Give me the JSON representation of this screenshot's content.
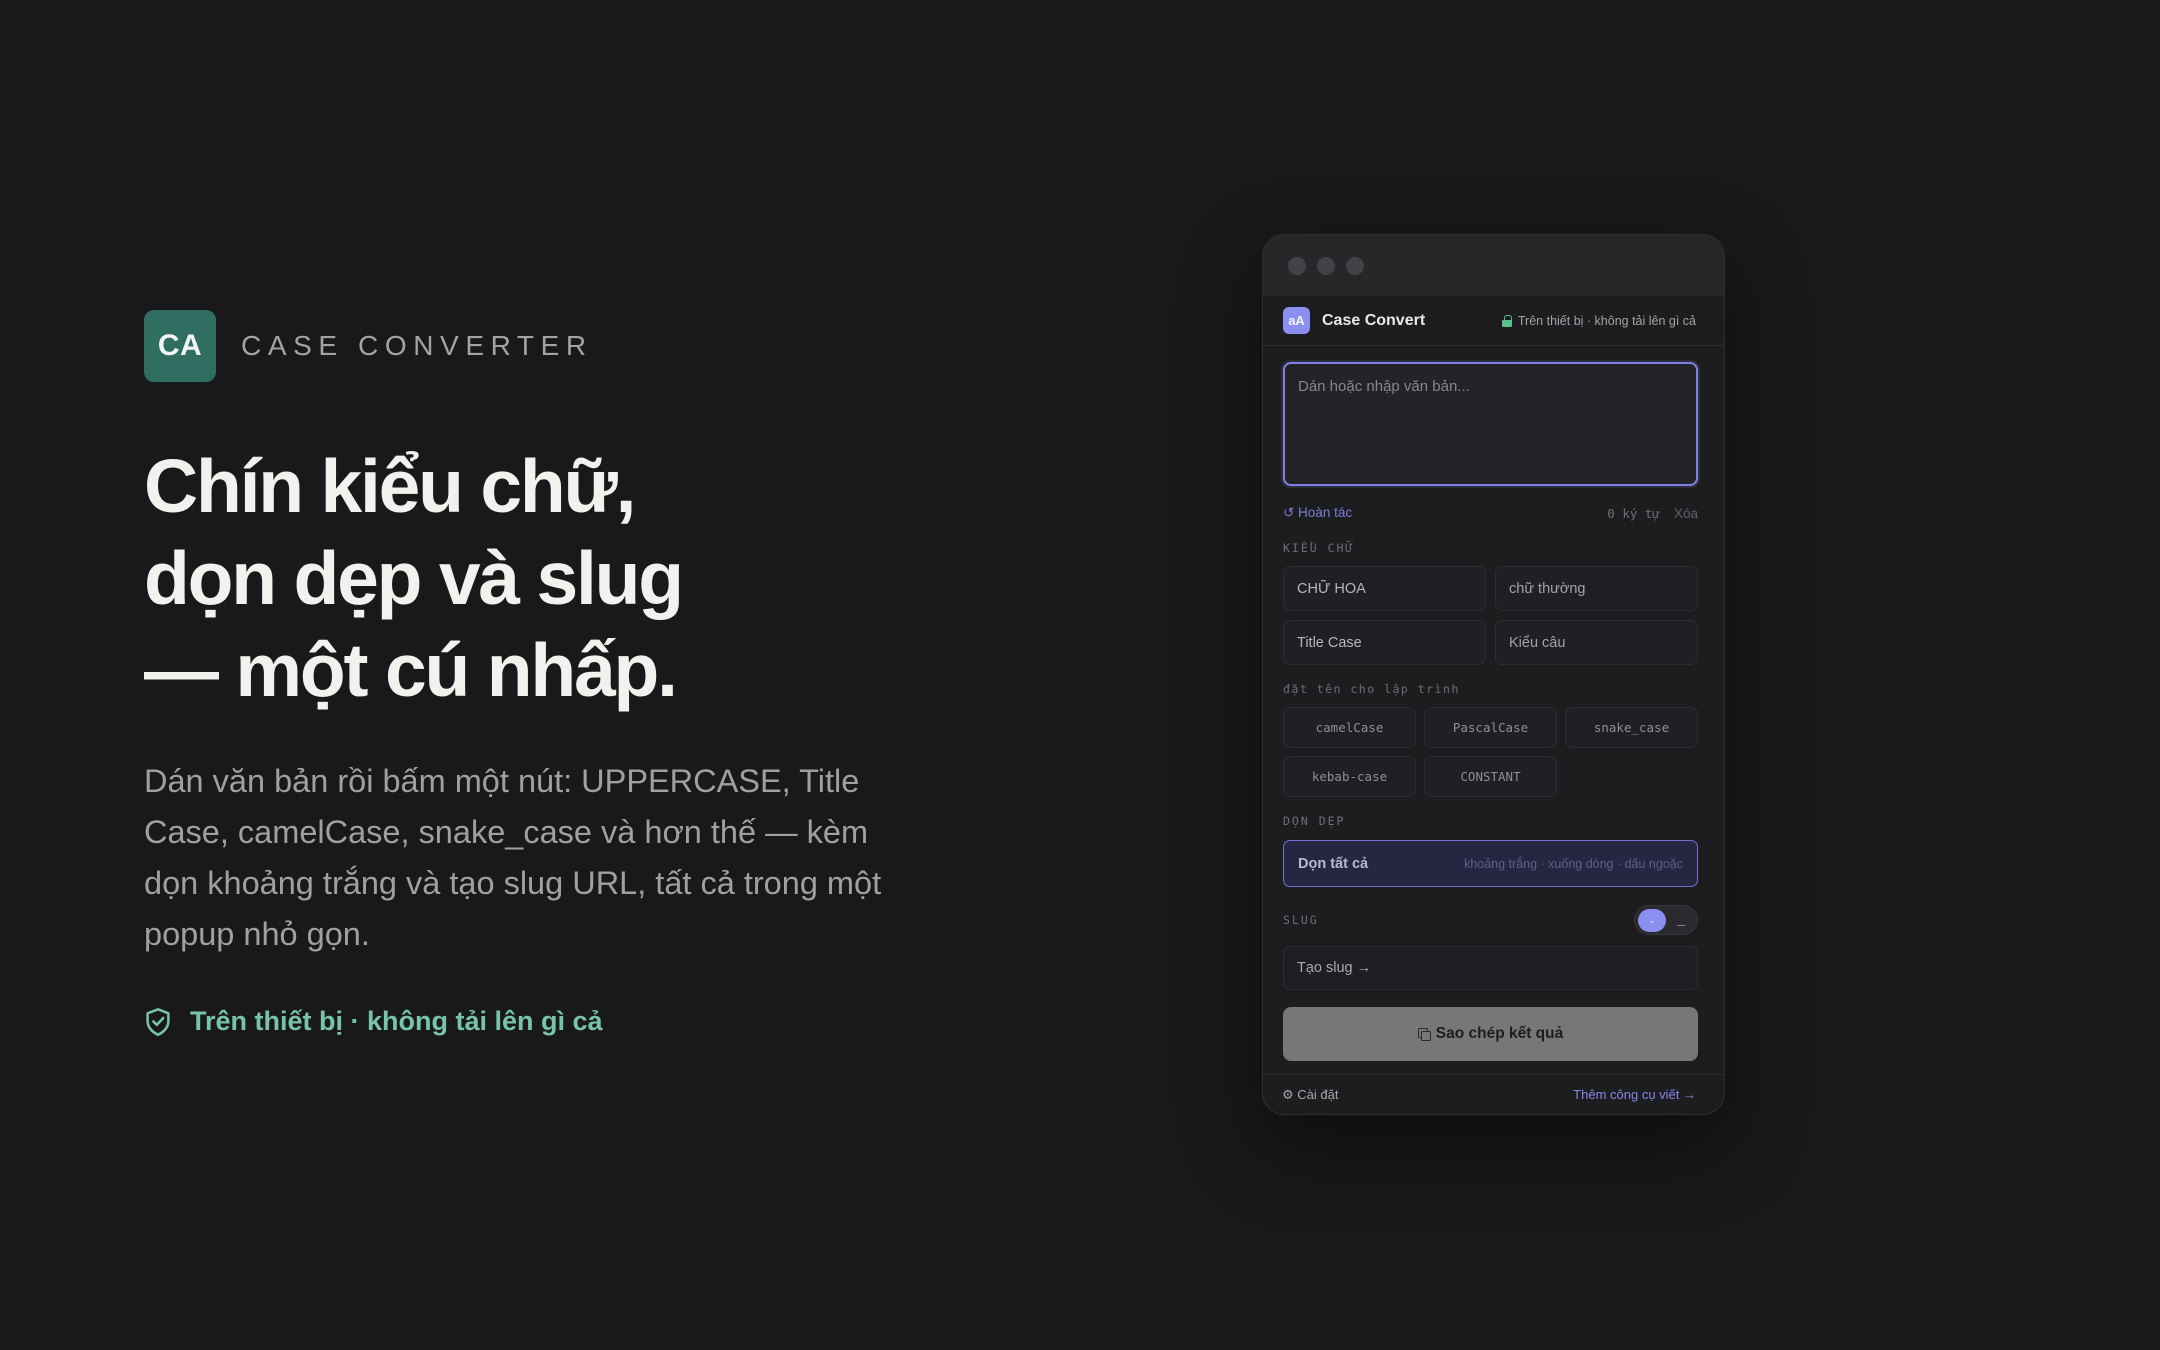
{
  "hero": {
    "logo_text": "CA",
    "brand": "CASE CONVERTER",
    "headline": [
      "Chín kiểu chữ,",
      "dọn dẹp và slug",
      "— một cú nhấp."
    ],
    "lede": "Dán văn bản rồi bấm một nút: UPPERCASE, Title Case, camelCase, snake_case và hơn thế — kèm dọn khoảng trắng và tạo slug URL, tất cả trong một popup nhỏ gọn.",
    "trust": "Trên thiết bị · không tải lên gì cả"
  },
  "popup": {
    "logo_text": "aA",
    "title": "Case Convert",
    "local_note": "Trên thiết bị · không tải lên gì cả",
    "input": {
      "value": "",
      "placeholder": "Dán hoặc nhập văn bản..."
    },
    "undo": "↺ Hoàn tác",
    "char_count": "0 ký tự",
    "clear": "Xóa",
    "case_label": "KIỂU CHỮ",
    "case_buttons": [
      "CHỮ HOA",
      "chữ thường",
      "Title Case",
      "Kiểu câu"
    ],
    "dev_label": "đặt tên cho lập trình",
    "dev_buttons": [
      "camelCase",
      "PascalCase",
      "snake_case",
      "kebab-case",
      "CONSTANT"
    ],
    "clean_label": "DỌN DẸP",
    "clean_button": "Dọn tất cả",
    "clean_hint": "khoảng trắng · xuống dòng · dấu ngoặc",
    "slug_label": "SLUG",
    "slug_toggle": {
      "selected": "-",
      "other": "_"
    },
    "slug_button": "Tạo slug →",
    "copy_button": "Sao chép kết quả",
    "settings": "⚙ Cài đặt",
    "more_tools": "Thêm công cụ viết →"
  },
  "colors": {
    "background": "#19191b",
    "brand_green": "#2f6e61",
    "accent": "#8b8ff0",
    "trust": "#77c4ab"
  }
}
